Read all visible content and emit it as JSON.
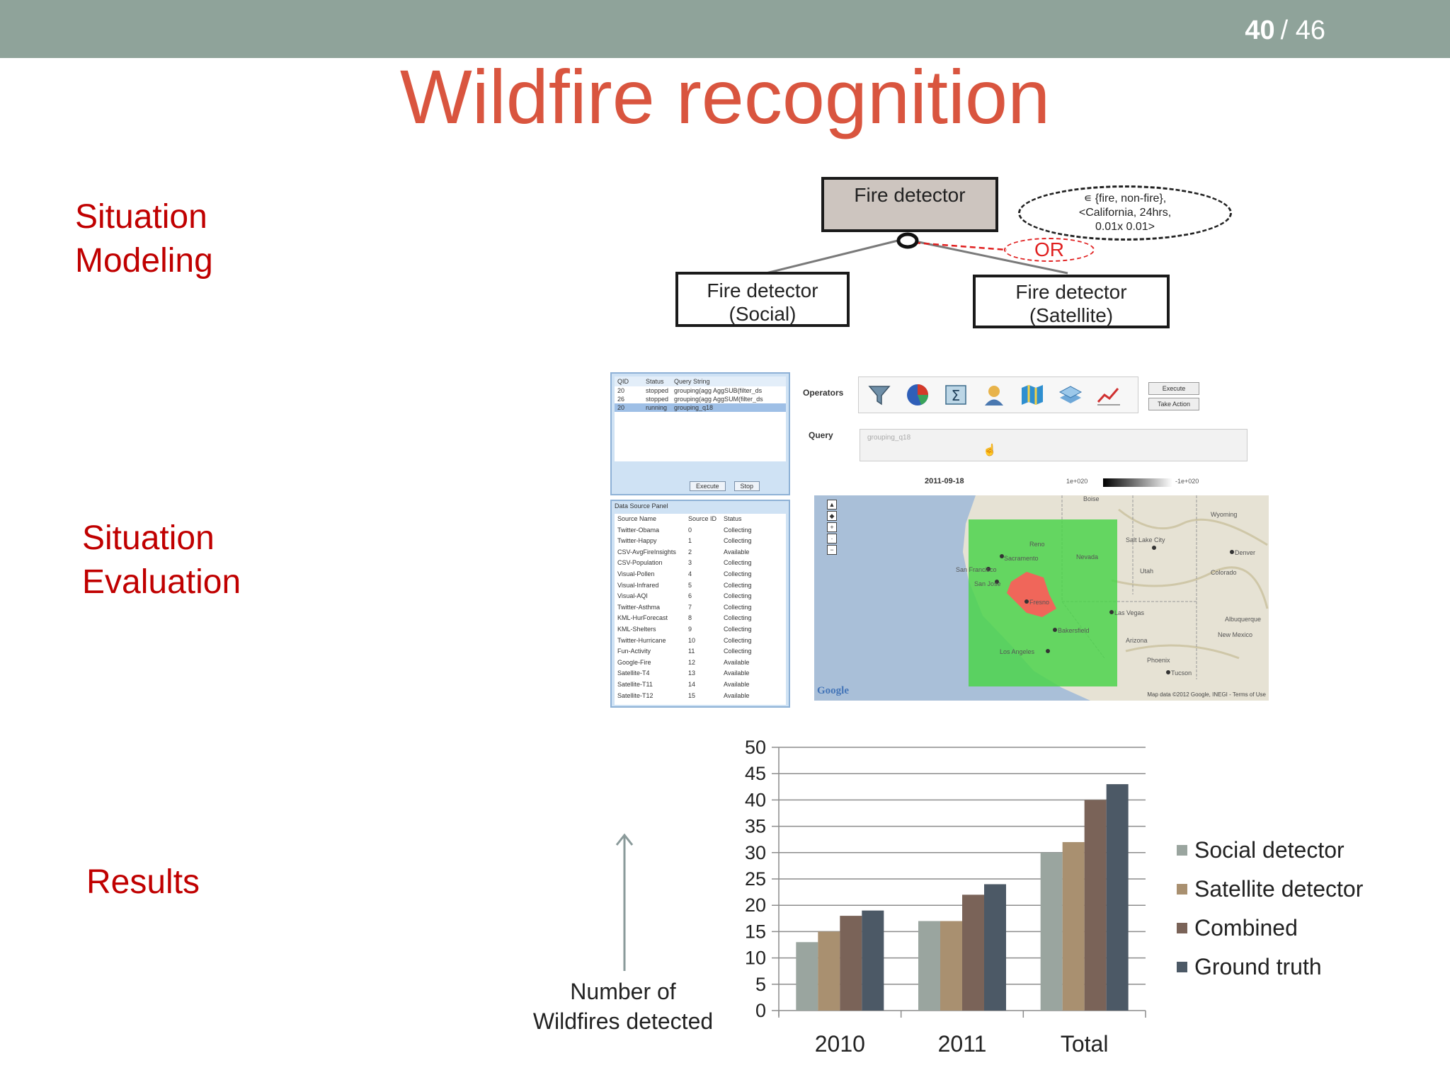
{
  "page": {
    "current": "40",
    "total": "/ 46"
  },
  "title": "Wildfire recognition",
  "sections": {
    "modeling": [
      "Situation",
      "Modeling"
    ],
    "evaluation": [
      "Situation",
      "Evaluation"
    ],
    "results": "Results"
  },
  "diagram": {
    "root": "Fire detector",
    "left": [
      "Fire detector",
      "(Social)"
    ],
    "right": [
      "Fire detector",
      "(Satellite)"
    ],
    "context": [
      "∊ {fire, non-fire},",
      "<California, 24hrs,",
      "0.01x 0.01>"
    ],
    "or_label": "OR"
  },
  "app": {
    "query_panel": {
      "headers": [
        "QID",
        "Status",
        "Query String"
      ],
      "rows": [
        [
          "20",
          "stopped",
          "grouping(agg AggSUB(filter_ds"
        ],
        [
          "26",
          "stopped",
          "grouping(agg AggSUM(filter_ds"
        ],
        [
          "20",
          "running",
          "grouping_q18"
        ]
      ],
      "execute": "Execute",
      "stop": "Stop"
    },
    "data_source_panel": {
      "title": "Data Source Panel",
      "headers": [
        "Source Name",
        "Source ID",
        "Status"
      ],
      "rows": [
        [
          "Twitter-Obama",
          "0",
          "Collecting"
        ],
        [
          "Twitter-Happy",
          "1",
          "Collecting"
        ],
        [
          "CSV-AvgFireInsights",
          "2",
          "Available"
        ],
        [
          "CSV-Population",
          "3",
          "Collecting"
        ],
        [
          "Visual-Pollen",
          "4",
          "Collecting"
        ],
        [
          "Visual-Infrared",
          "5",
          "Collecting"
        ],
        [
          "Visual-AQI",
          "6",
          "Collecting"
        ],
        [
          "Twitter-Asthma",
          "7",
          "Collecting"
        ],
        [
          "KML-HurForecast",
          "8",
          "Collecting"
        ],
        [
          "KML-Shelters",
          "9",
          "Collecting"
        ],
        [
          "Twitter-Hurricane",
          "10",
          "Collecting"
        ],
        [
          "Fun-Activity",
          "11",
          "Collecting"
        ],
        [
          "Google-Fire",
          "12",
          "Available"
        ],
        [
          "Satellite-T4",
          "13",
          "Available"
        ],
        [
          "Satellite-T11",
          "14",
          "Available"
        ],
        [
          "Satellite-T12",
          "15",
          "Available"
        ]
      ]
    },
    "operators_label": "Operators",
    "operator_icons": [
      "filter-icon",
      "pie-chart-icon",
      "sum-icon",
      "person-icon",
      "map-icon",
      "layers-icon",
      "trend-icon"
    ],
    "side_buttons": [
      "Execute",
      "Take Action"
    ],
    "query_label": "Query",
    "query_value": "grouping_q18",
    "map": {
      "date": "2011-09-18",
      "scale_low": "1e+020",
      "scale_high": "-1e+020",
      "attribution": "Google",
      "copyright": "Map data ©2012 Google, INEGI - Terms of Use",
      "places": [
        "Sacramento",
        "San Francisco",
        "San Jose",
        "Fresno",
        "Bakersfield",
        "Los Angeles",
        "Las Vegas",
        "Phoenix",
        "Tucson",
        "Salt Lake City",
        "Denver",
        "Reno",
        "Nevada",
        "Utah",
        "Arizona",
        "Wyoming",
        "Colorado",
        "New Mexico",
        "Albuquerque",
        "Boise"
      ]
    }
  },
  "chart_data": {
    "type": "bar",
    "categories": [
      "2010",
      "2011",
      "Total"
    ],
    "series": [
      {
        "name": "Social detector",
        "values": [
          13,
          17,
          30
        ],
        "color": "#9aa59f"
      },
      {
        "name": "Satellite detector",
        "values": [
          15,
          17,
          32
        ],
        "color": "#a99070"
      },
      {
        "name": "Combined",
        "values": [
          18,
          22,
          40
        ],
        "color": "#7a6358"
      },
      {
        "name": "Ground truth",
        "values": [
          19,
          24,
          43
        ],
        "color": "#4c5966"
      }
    ],
    "ylim": [
      0,
      50
    ],
    "yticks": [
      0,
      5,
      10,
      15,
      20,
      25,
      30,
      35,
      40,
      45,
      50
    ],
    "ylabel": [
      "Number of",
      "Wildfires detected"
    ],
    "grid": true,
    "legend": "right"
  }
}
